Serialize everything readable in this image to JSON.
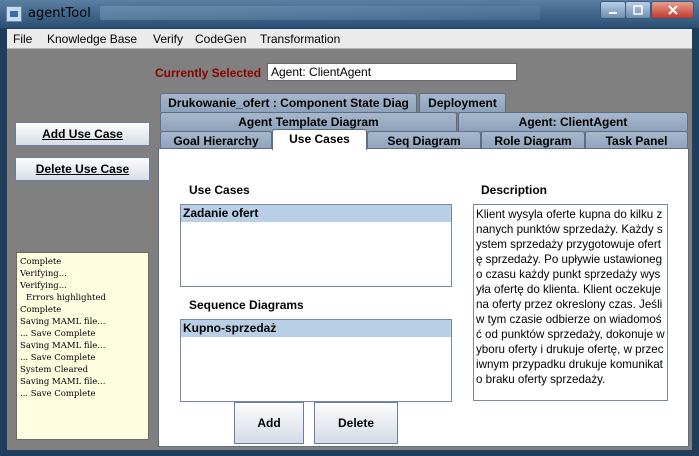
{
  "window": {
    "title": "agentTool"
  },
  "menubar": [
    "File",
    "Knowledge Base",
    "Verify",
    "CodeGen",
    "Transformation"
  ],
  "selection": {
    "label": "Currently Selected",
    "value": "Agent: ClientAgent"
  },
  "sidebar": {
    "add_label": "Add Use Case",
    "delete_label": "Delete Use Case"
  },
  "log": [
    "Complete",
    "Verifying...",
    "Verifying...",
    "   Errors highlighted",
    "Complete",
    "Saving MAML file...",
    "... Save Complete",
    "Saving MAML file...",
    "... Save Complete",
    "System Cleared",
    "Saving MAML file...",
    "... Save Complete"
  ],
  "tabs": {
    "row1": [
      "Drukowanie_ofert : Component State Diag",
      "Deployment"
    ],
    "row2": [
      "Agent Template Diagram",
      "Agent: ClientAgent"
    ],
    "row3": [
      "Goal Hierarchy",
      "Use Cases",
      "Seq Diagram",
      "Role Diagram",
      "Task Panel"
    ],
    "active": "Use Cases"
  },
  "panel": {
    "use_cases_label": "Use Cases",
    "use_cases": [
      "Zadanie ofert"
    ],
    "sequence_label": "Sequence Diagrams",
    "sequences": [
      "Kupno-sprzedaż"
    ],
    "description_label": "Description",
    "description": "Klient wysyla oferte kupna do kilku znanych punktów sprzedaży. Każdy system sprzedaży przygotowuje ofertę sprzedaży. Po upływie ustawionego czasu każdy punkt sprzedaży wysyła ofertę do klienta. Klient oczekuje na oferty przez okreslony czas. Jeśli w tym czasie odbierze on wiadomość od punktów sprzedaży, dokonuje wyboru oferty i drukuje ofertę, w przeciwnym przypadku drukuje komunikat o braku oferty sprzedaży.",
    "add_label": "Add",
    "delete_label": "Delete"
  }
}
